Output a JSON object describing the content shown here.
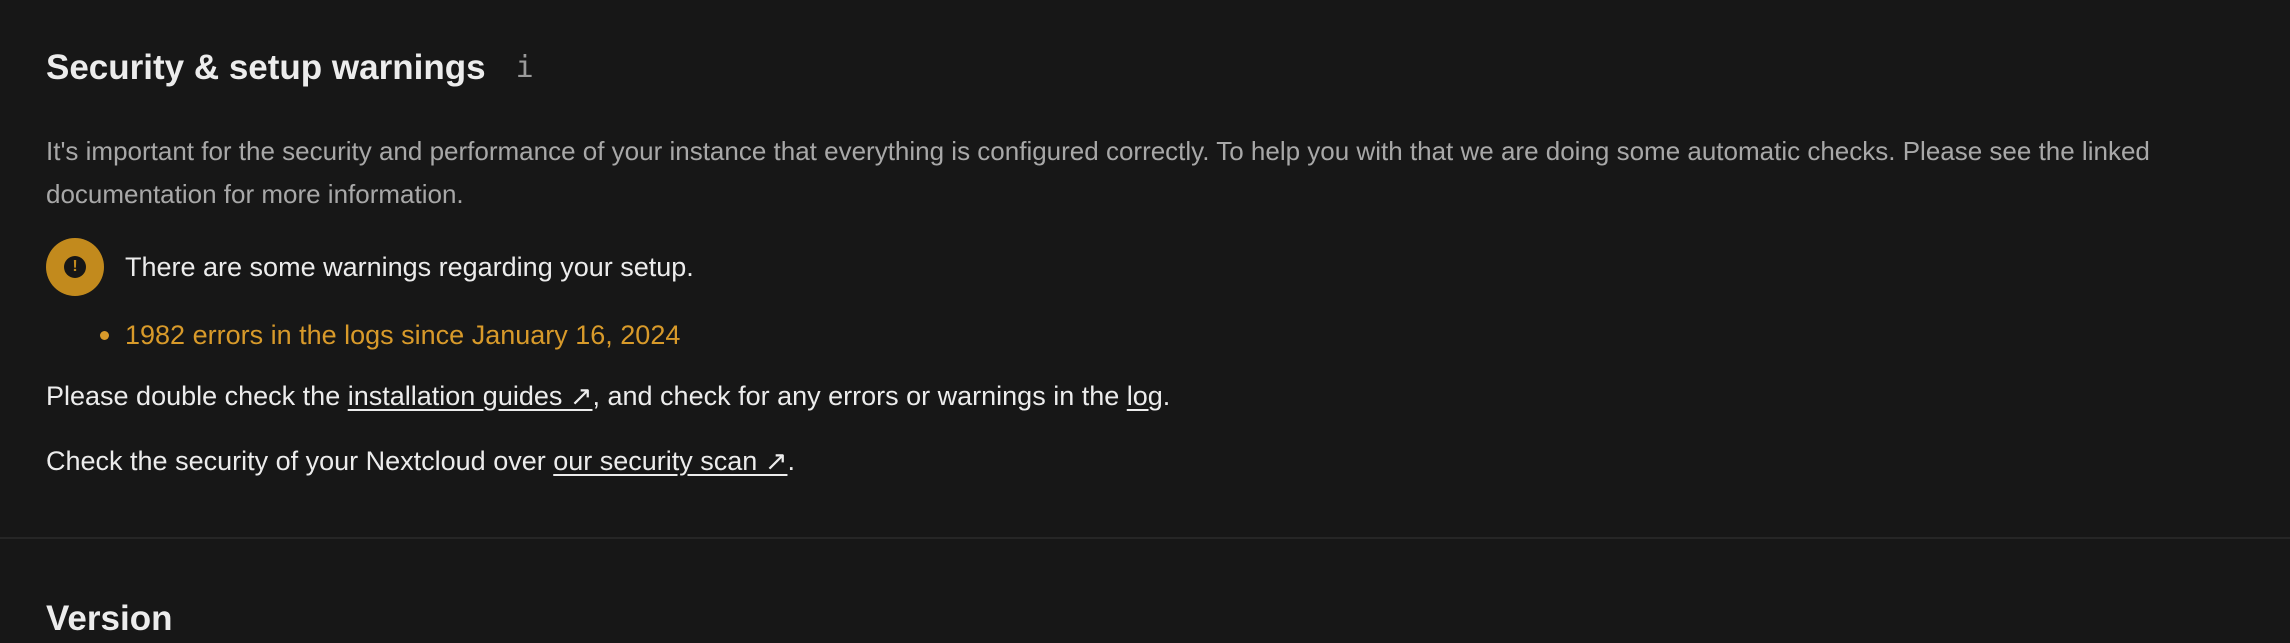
{
  "security": {
    "title": "Security & setup warnings",
    "info_icon": "i",
    "intro": "It's important for the security and performance of your instance that everything is configured correctly. To help you with that we are doing some automatic checks. Please see the linked documentation for more information.",
    "warning_icon": "!",
    "warning_text": "There are some warnings regarding your setup.",
    "warnings": [
      "1982 errors in the logs since January 16, 2024"
    ],
    "double_check": {
      "prefix": "Please double check the ",
      "guides_link": "installation guides ↗",
      "middle": ", and check for any errors or warnings in the ",
      "log_link": "log",
      "suffix": "."
    },
    "scan": {
      "prefix": "Check the security of your Nextcloud over ",
      "scan_link": "our security scan ↗",
      "suffix": "."
    },
    "colors": {
      "background": "#171717",
      "warning": "#c28a1d",
      "warning_text": "#d89a2a",
      "muted_text": "#a8a8a8"
    }
  },
  "version": {
    "title": "Version"
  }
}
